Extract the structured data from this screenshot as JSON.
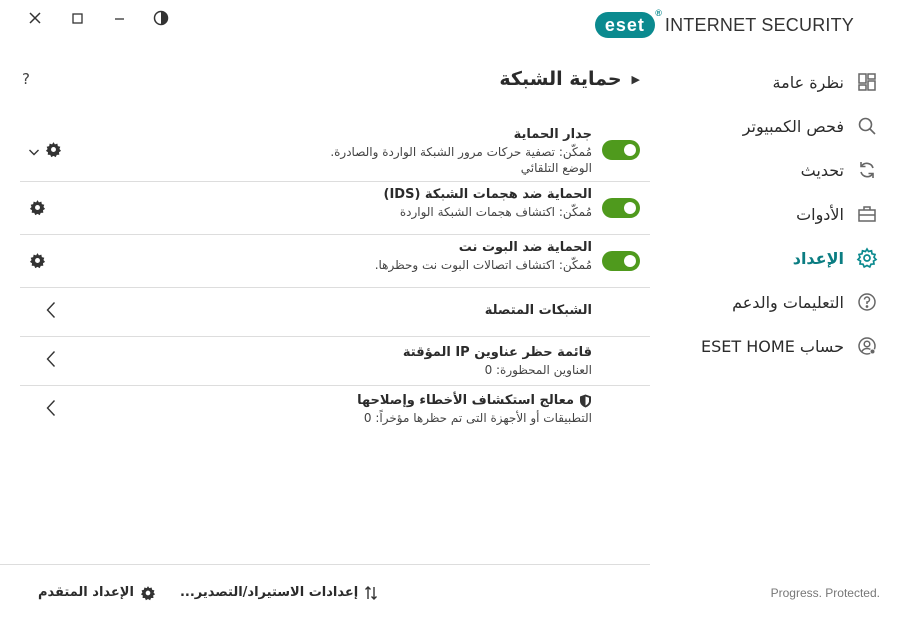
{
  "brand": {
    "logo": "eset",
    "product": "INTERNET SECURITY"
  },
  "window_controls": {
    "close": "close-icon",
    "maximize": "maximize-icon",
    "minimize": "minimize-icon",
    "theme": "contrast-icon"
  },
  "sidebar": {
    "items": [
      {
        "label": "نظرة عامة",
        "icon": "dashboard-icon"
      },
      {
        "label": "فحص الكمبيوتر",
        "icon": "search-icon"
      },
      {
        "label": "تحديث",
        "icon": "refresh-icon"
      },
      {
        "label": "الأدوات",
        "icon": "toolbox-icon"
      },
      {
        "label": "الإعداد",
        "icon": "gear-icon",
        "active": true
      },
      {
        "label": "التعليمات والدعم",
        "icon": "help-icon"
      },
      {
        "label": "حساب ESET HOME",
        "icon": "user-icon"
      }
    ],
    "footer": "Progress. Protected."
  },
  "main": {
    "title": "حماية الشبكة",
    "help": "?",
    "rows": [
      {
        "title": "جدار الحماية",
        "lines": [
          "مُمكّن: تصفية حركات مرور الشبكة الواردة والصادرة.",
          "الوضع التلقائي"
        ],
        "enabled": true
      },
      {
        "title": "الحماية ضد هجمات الشبكة (IDS)",
        "lines": [
          "مُمكّن: اكتشاف هجمات الشبكة الواردة"
        ],
        "enabled": true
      },
      {
        "title": "الحماية ضد البوت نت",
        "lines": [
          "مُمكّن: اكتشاف اتصالات البوت نت وحظرها."
        ],
        "enabled": true
      },
      {
        "title": "الشبكات المتصلة",
        "lines": []
      },
      {
        "title": "قائمة حظر عناوين IP المؤقتة",
        "lines": [
          "العناوين المحظورة: 0"
        ]
      },
      {
        "title": "معالج استكشاف الأخطاء وإصلاحها",
        "lines": [
          "التطبيقات أو الأجهزة التى تم حظرها مؤخراً: 0"
        ]
      }
    ]
  },
  "bottom": {
    "import_export": "إعدادات الاستيراد/التصدير...",
    "advanced": "الإعداد المتقدم"
  }
}
